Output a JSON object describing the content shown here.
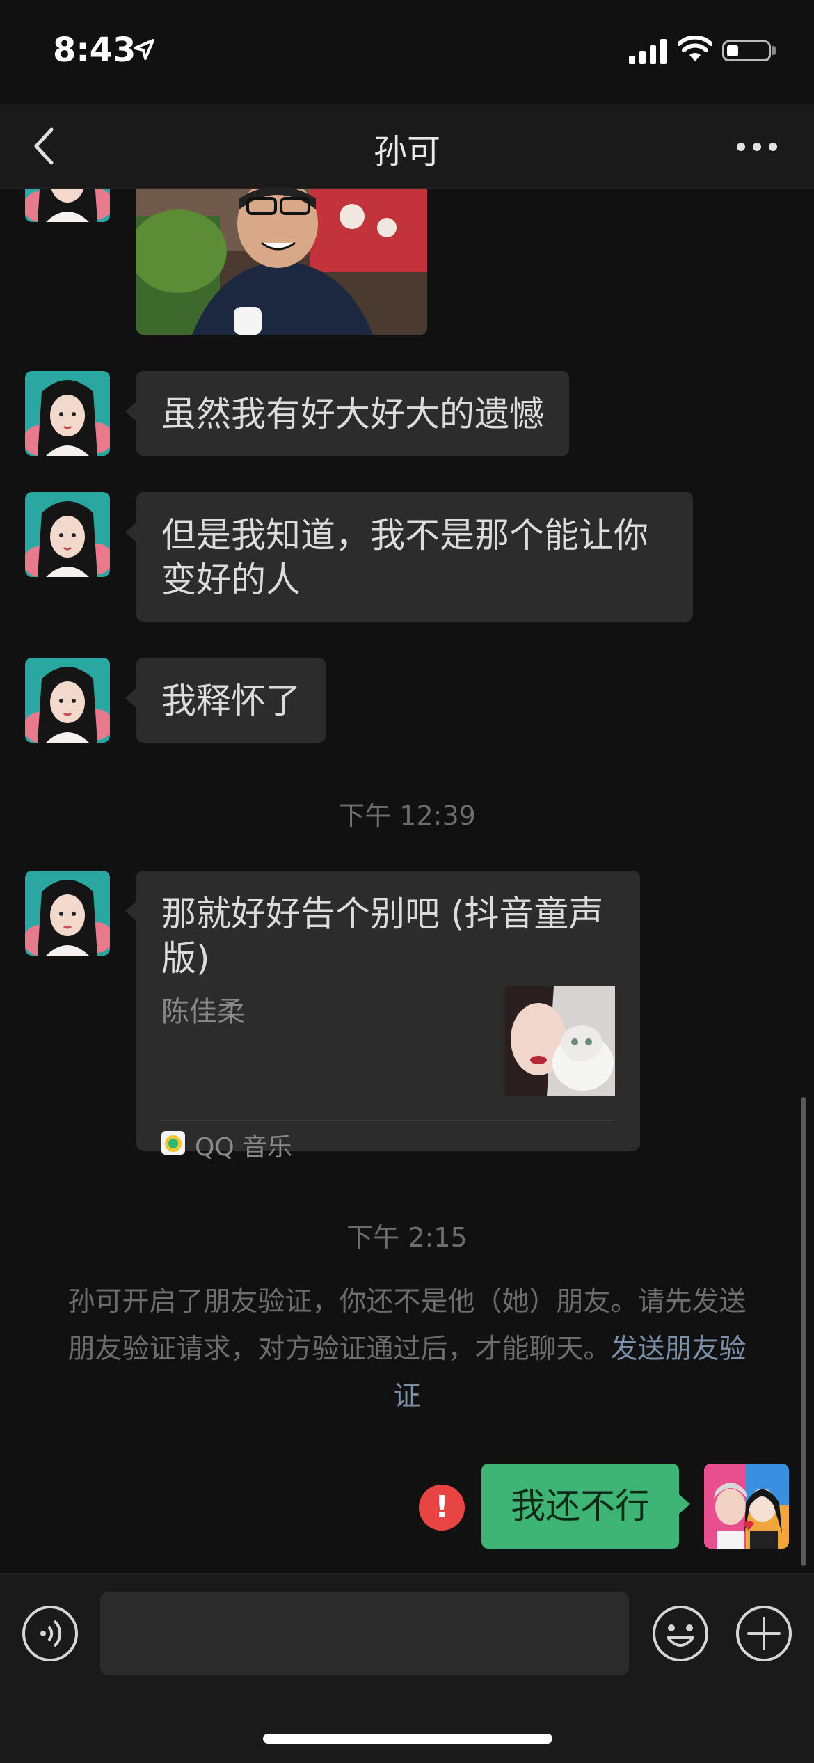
{
  "status_bar": {
    "time": "8:43"
  },
  "nav": {
    "title": "孙可"
  },
  "messages": [
    {
      "type": "text",
      "text": "虽然我有好大好大的遗憾"
    },
    {
      "type": "text",
      "text": "但是我知道，我不是那个能让你变好的人"
    },
    {
      "type": "text",
      "text": "我释怀了"
    },
    {
      "type": "timestamp",
      "text": "下午 12:39"
    },
    {
      "type": "music",
      "title": "那就好好告个别吧 (抖音童声版)",
      "artist": "陈佳柔",
      "source": "QQ 音乐"
    },
    {
      "type": "timestamp",
      "text": "下午 2:15"
    },
    {
      "type": "system",
      "text": "孙可开启了朋友验证，你还不是他（她）朋友。请先发送朋友验证请求，对方验证通过后，才能聊天。",
      "link": "发送朋友验证"
    },
    {
      "type": "sent",
      "text": "我还不行",
      "status": "failed"
    }
  ],
  "colors": {
    "background": "#111111",
    "bubble_incoming": "#2c2c2c",
    "bubble_outgoing": "#3eb575",
    "error": "#e84443",
    "link": "#7d90a9"
  },
  "icons": [
    "back-chevron-icon",
    "more-icon",
    "voice-icon",
    "emoji-icon",
    "plus-icon",
    "error-icon",
    "qq-music-icon"
  ]
}
